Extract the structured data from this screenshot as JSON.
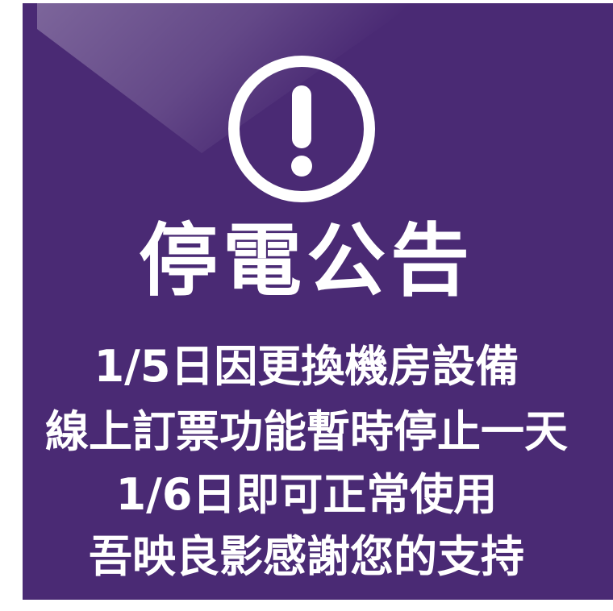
{
  "notice": {
    "title": "停電公告",
    "lines": [
      "1/5日因更換機房設備",
      "線上訂票功能暫時停止一天",
      "1/6日即可正常使用",
      "吾映良影感謝您的支持"
    ]
  },
  "icons": {
    "warning": "exclamation-circle-icon"
  },
  "colors": {
    "background": "#4a2a74",
    "text": "#ffffff"
  }
}
